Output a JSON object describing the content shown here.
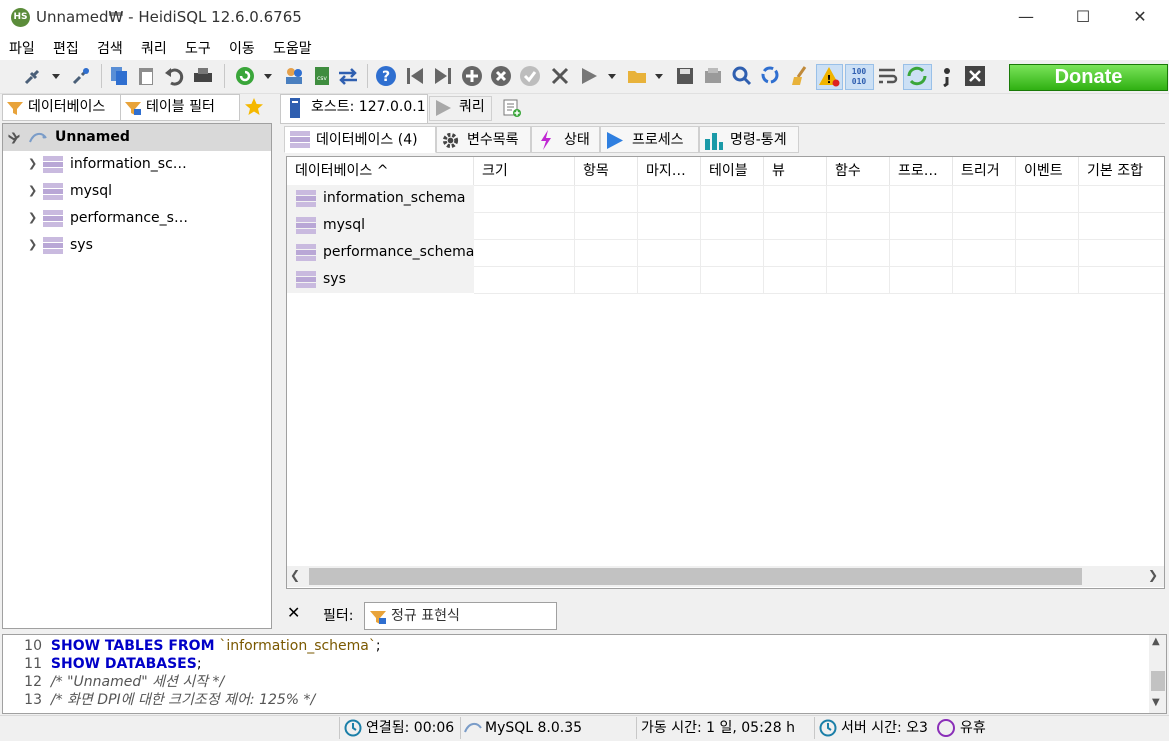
{
  "window": {
    "title": "Unnamed₩ - HeidiSQL 12.6.0.6765",
    "app_icon_text": "HS",
    "minimize": "—",
    "maximize": "☐",
    "close": "✕"
  },
  "menu": [
    "파일",
    "편집",
    "검색",
    "쿼리",
    "도구",
    "이동",
    "도움말"
  ],
  "toolbar": {
    "donate_label": "Donate"
  },
  "left_panel": {
    "tabs": [
      "데이터베이스",
      "테이블 필터"
    ],
    "root": "Unnamed",
    "databases": [
      "information_sc…",
      "mysql",
      "performance_s…",
      "sys"
    ]
  },
  "main_tabs": {
    "host_tab": "호스트: 127.0.0.1",
    "query_tab": "쿼리"
  },
  "sub_tabs": [
    "데이터베이스 (4)",
    "변수목록",
    "상태",
    "프로세스",
    "명령-통계"
  ],
  "grid": {
    "columns": [
      "데이터베이스 ^",
      "크기",
      "항목",
      "마지…",
      "테이블",
      "뷰",
      "함수",
      "프로…",
      "트리거",
      "이벤트",
      "기본 조합"
    ],
    "rows": [
      "information_schema",
      "mysql",
      "performance_schema",
      "sys"
    ]
  },
  "filter": {
    "close": "✕",
    "label": "필터:",
    "placeholder": "정규 표현식"
  },
  "sql_log": [
    {
      "num": "10",
      "parts": [
        [
          "kw",
          "SHOW TABLES FROM "
        ],
        [
          "str",
          "`information_schema`"
        ],
        [
          "plain",
          ";"
        ]
      ]
    },
    {
      "num": "11",
      "parts": [
        [
          "kw",
          "SHOW DATABASES"
        ],
        [
          "plain",
          ";"
        ]
      ]
    },
    {
      "num": "12",
      "parts": [
        [
          "cm",
          "/* \"Unnamed\" 세션 시작 */"
        ]
      ]
    },
    {
      "num": "13",
      "parts": [
        [
          "cm",
          "/* 화면 DPI에 대한 크기조정 제어: 125% */"
        ]
      ]
    }
  ],
  "status": {
    "connected": "연결됨: 00:06",
    "server_version": "MySQL 8.0.35",
    "uptime": "가동 시간: 1 일, 05:28 h",
    "server_time": "서버 시간: 오3",
    "idle": "유휴"
  },
  "colors": {
    "accent_blue": "#2f6fd0",
    "donate_green": "#3cc01a",
    "db_icon": "#b9a7d6",
    "keyword": "#0000c8"
  }
}
